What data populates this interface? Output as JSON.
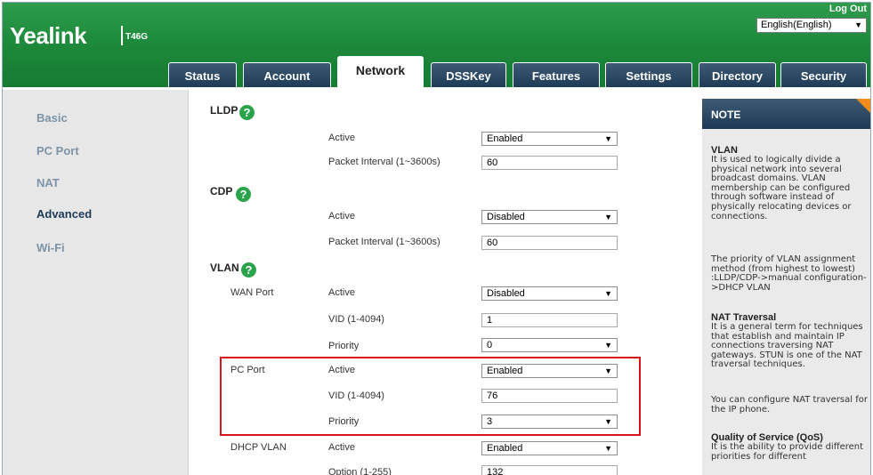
{
  "header": {
    "brand": "Yealink",
    "model": "T46G",
    "logout": "Log Out",
    "language": "English(English)"
  },
  "tabs": [
    {
      "label": "Status"
    },
    {
      "label": "Account"
    },
    {
      "label": "Network"
    },
    {
      "label": "DSSKey"
    },
    {
      "label": "Features"
    },
    {
      "label": "Settings"
    },
    {
      "label": "Directory"
    },
    {
      "label": "Security"
    }
  ],
  "active_tab": "Network",
  "sidebar": {
    "items": [
      {
        "label": "Basic"
      },
      {
        "label": "PC Port"
      },
      {
        "label": "NAT"
      },
      {
        "label": "Advanced"
      },
      {
        "label": "Wi-Fi"
      }
    ],
    "active": "Advanced"
  },
  "main": {
    "lldp": {
      "title": "LLDP",
      "active_label": "Active",
      "active_value": "Enabled",
      "interval_label": "Packet Interval (1~3600s)",
      "interval_value": "60"
    },
    "cdp": {
      "title": "CDP",
      "active_label": "Active",
      "active_value": "Disabled",
      "interval_label": "Packet Interval (1~3600s)",
      "interval_value": "60"
    },
    "vlan": {
      "title": "VLAN",
      "wan": {
        "label": "WAN Port",
        "active_label": "Active",
        "active_value": "Disabled",
        "vid_label": "VID (1-4094)",
        "vid_value": "1",
        "priority_label": "Priority",
        "priority_value": "0"
      },
      "pc": {
        "label": "PC Port",
        "active_label": "Active",
        "active_value": "Enabled",
        "vid_label": "VID (1-4094)",
        "vid_value": "76",
        "priority_label": "Priority",
        "priority_value": "3"
      },
      "dhcp": {
        "label": "DHCP VLAN",
        "active_label": "Active",
        "active_value": "Enabled",
        "option_label": "Option (1-255)",
        "option_value": "132"
      }
    },
    "help_glyph": "?"
  },
  "note": {
    "title": "NOTE",
    "vlan_h": "VLAN",
    "vlan_p1": "It is used to logically divide a physical network into several broadcast domains. VLAN membership can be configured through software instead of physically relocating devices or connections.",
    "vlan_p2": "The priority of VLAN assignment method (from highest to lowest) :LLDP/CDP->manual configuration->DHCP VLAN",
    "nat_h": "NAT Traversal",
    "nat_p1": "It is a general term for techniques that establish and maintain IP connections traversing NAT gateways. STUN is one of the NAT traversal techniques.",
    "nat_p2": "You can configure NAT traversal for the IP phone.",
    "qos_h": "Quality of Service (QoS)",
    "qos_p": "It is the ability to provide different priorities for different"
  },
  "colors": {
    "header_green": "#1e8a3c",
    "tab_navy": "#1d3a56",
    "help_green": "#2aa44a",
    "highlight_red": "#d9141b",
    "note_corner_orange": "#f28c1c"
  }
}
